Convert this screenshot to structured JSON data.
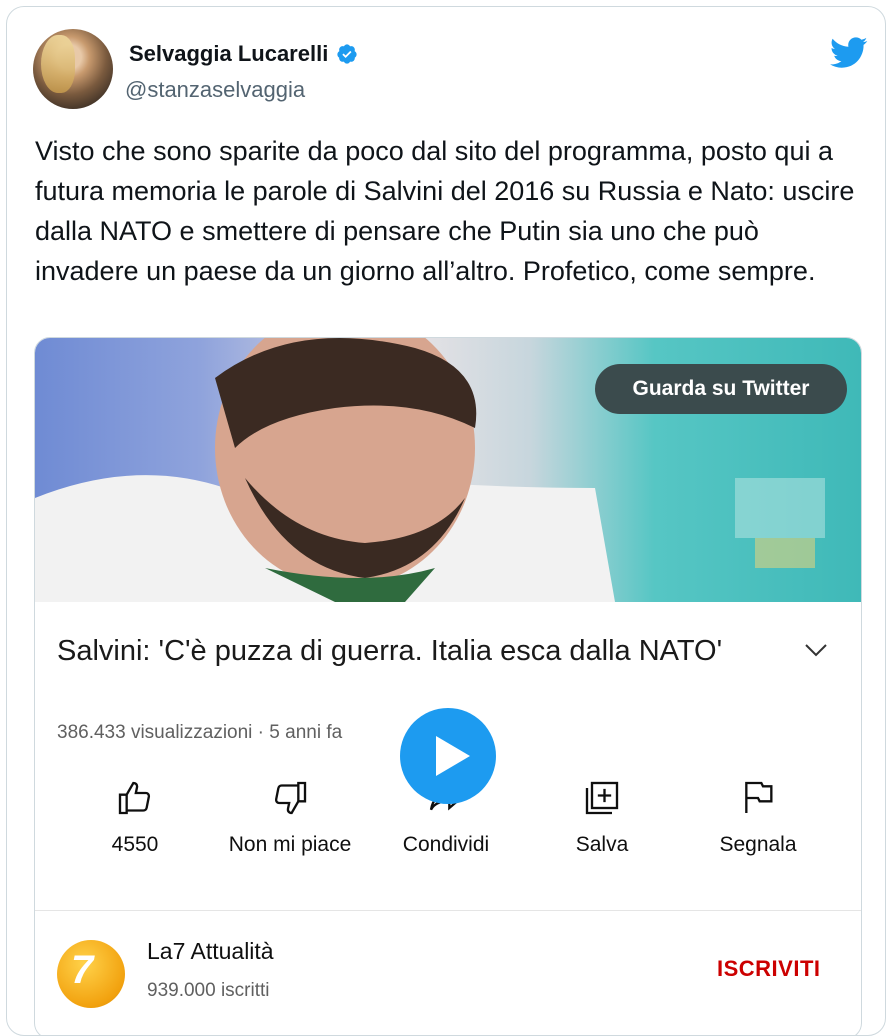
{
  "author": {
    "name": "Selvaggia Lucarelli",
    "handle": "@stanzaselvaggia"
  },
  "tweet": {
    "text": "Visto che sono sparite da poco dal sito del programma, posto qui a futura memoria le parole di Salvini del 2016 su Russia e Nato: uscire dalla NATO e smettere di pensare che Putin sia uno che può invadere un paese da un giorno all’altro. Profetico, come sempre."
  },
  "embed": {
    "watch_label": "Guarda su Twitter",
    "video_title": "Salvini: 'C'è puzza di guerra. Italia esca dalla NATO'",
    "views": "386.433 visualizzazioni · 5 anni fa",
    "actions": [
      {
        "label": "4550",
        "icon": "thumbs-up-icon"
      },
      {
        "label": "Non mi piace",
        "icon": "thumbs-down-icon"
      },
      {
        "label": "Condividi",
        "icon": "share-icon"
      },
      {
        "label": "Salva",
        "icon": "add-to-playlist-icon"
      },
      {
        "label": "Segnala",
        "icon": "flag-icon"
      }
    ],
    "channel": {
      "name": "La7 Attualità",
      "subscribers": "939.000 iscritti",
      "subscribe_label": "ISCRIVITI"
    }
  },
  "colors": {
    "twitter_blue": "#1d9bf0",
    "subscribe_red": "#cc0000"
  }
}
